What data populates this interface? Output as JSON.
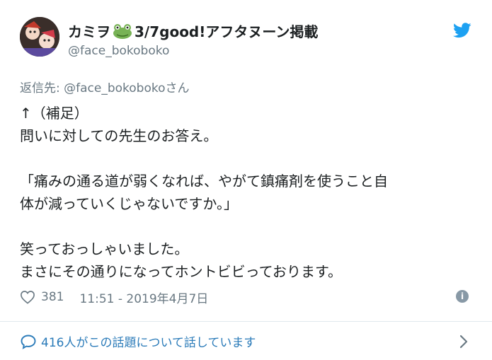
{
  "author": {
    "name_part1": "カミヲ",
    "name_part2": "3/7good!アフタヌーン掲載",
    "handle": "@face_bokoboko"
  },
  "reply": {
    "prefix": "返信先: ",
    "mention": "@face_bokoboko",
    "suffix": "さん"
  },
  "tweet": {
    "lines": [
      "↑（補足）",
      "問いに対しての先生のお答え。",
      "",
      "「痛みの通る道が弱くなれば、やがて鎮痛剤を使うこと自",
      "体が減っていくじゃないですか。」",
      "",
      "笑っておっしゃいました。",
      "まさにその通りになってホントビビっております。"
    ]
  },
  "meta": {
    "likes": "381",
    "timestamp": "11:51 - 2019年4月7日"
  },
  "footer": {
    "conversation": "416人がこの話題について話しています"
  },
  "colors": {
    "brand_blue": "#1da1f2",
    "link_blue": "#2b7bb9",
    "muted": "#697882",
    "text": "#1c2022"
  },
  "icons": [
    "avatar",
    "frog-emoji",
    "twitter-bird-icon",
    "heart-icon",
    "info-icon",
    "speech-bubble-icon",
    "chevron-right-icon"
  ]
}
